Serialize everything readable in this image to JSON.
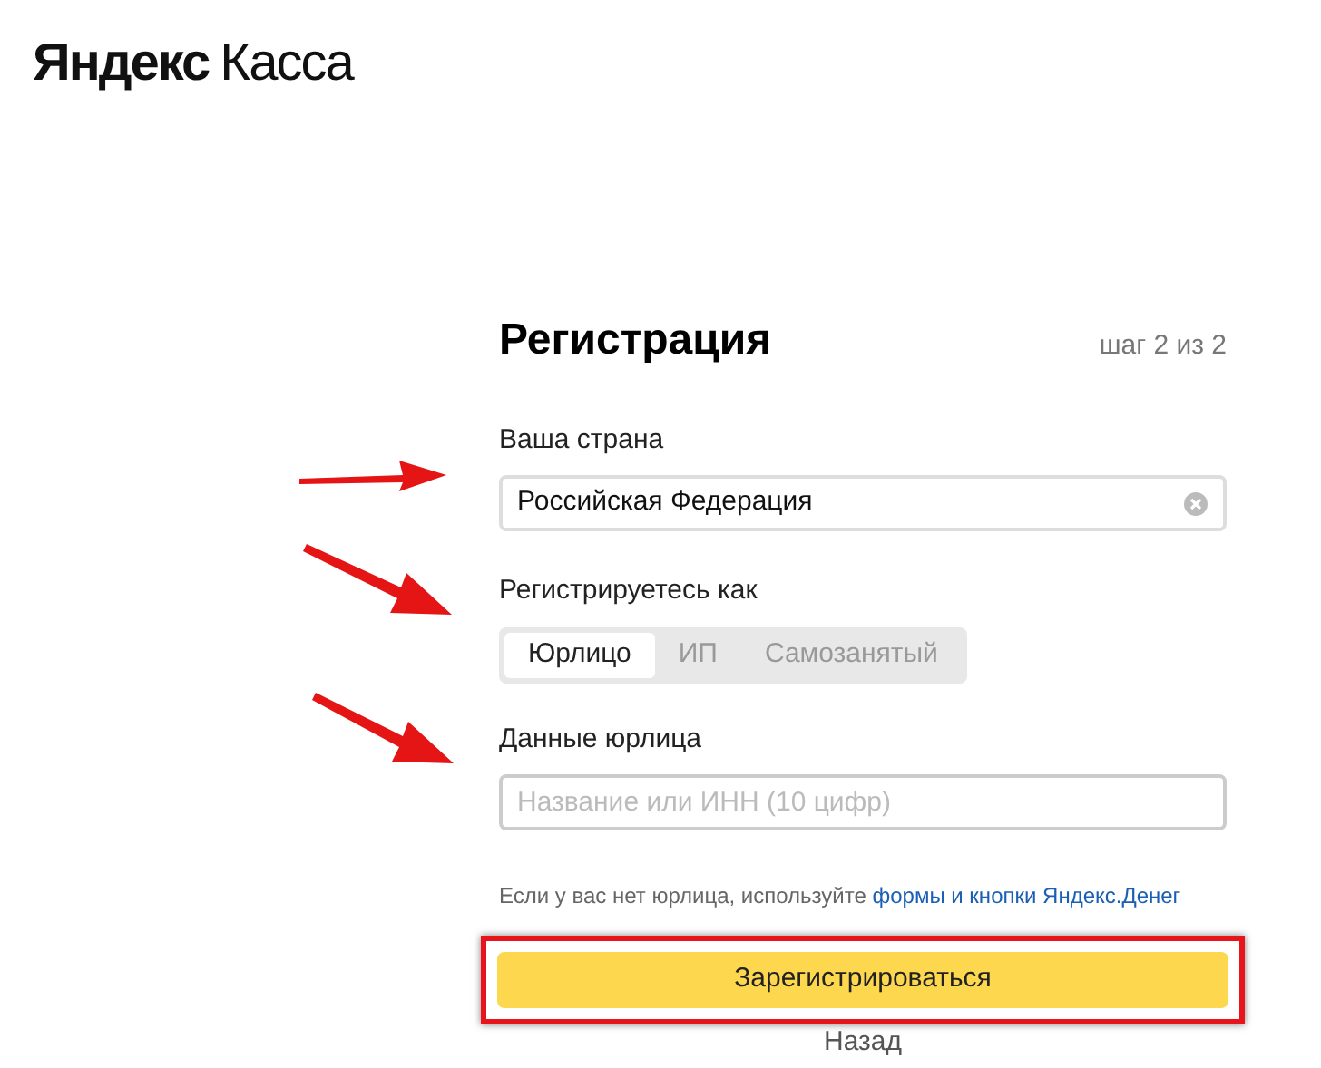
{
  "logo": {
    "brand": "Яндекс",
    "product": "Касса"
  },
  "form": {
    "title": "Регистрация",
    "step": "шаг 2 из 2",
    "country": {
      "label": "Ваша страна",
      "value": "Российская Федерация"
    },
    "register_as": {
      "label": "Регистрируетесь как",
      "options": [
        {
          "label": "Юрлицо",
          "selected": true
        },
        {
          "label": "ИП",
          "selected": false
        },
        {
          "label": "Самозанятый",
          "selected": false
        }
      ]
    },
    "company": {
      "label": "Данные юрлица",
      "placeholder": "Название или ИНН (10 цифр)"
    },
    "hint": {
      "text": "Если у вас нет юрлица, используйте ",
      "link": "формы и кнопки Яндекс.Денег"
    },
    "submit": {
      "label": "Зарегистрироваться",
      "highlighted": true
    },
    "back": "Назад"
  }
}
